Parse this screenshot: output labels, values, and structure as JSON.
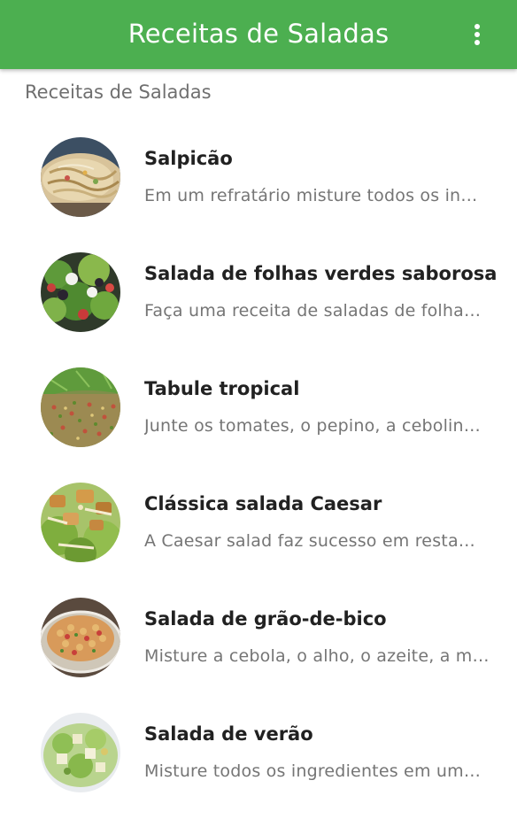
{
  "app_bar": {
    "title": "Receitas de Saladas",
    "color": "#4caf50",
    "overflow_icon": "more-vert-icon"
  },
  "section_header": "Receitas de Saladas",
  "recipes": [
    {
      "title": "Salpicão",
      "description": "Em um refratário misture todos os in…"
    },
    {
      "title": "Salada de folhas verdes saborosa",
      "description": "Faça uma receita de saladas de folha…"
    },
    {
      "title": "Tabule tropical",
      "description": "Junte os tomates, o pepino, a cebolin…"
    },
    {
      "title": "Clássica salada Caesar",
      "description": "A Caesar salad faz sucesso em resta…"
    },
    {
      "title": "Salada de grão-de-bico",
      "description": "Misture a cebola, o alho, o azeite, a m…"
    },
    {
      "title": "Salada de verão",
      "description": "Misture todos os ingredientes em um…"
    }
  ]
}
